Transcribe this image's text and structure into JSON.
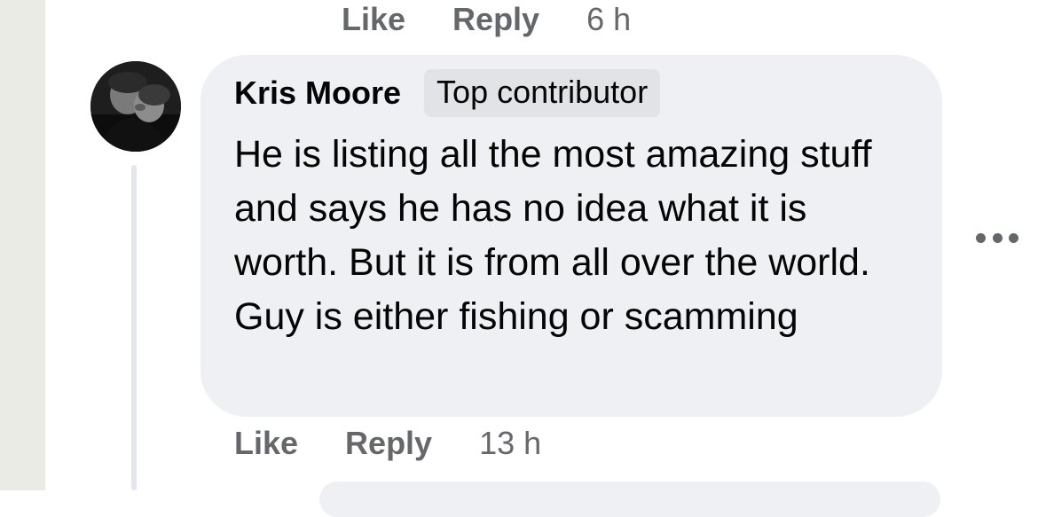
{
  "previous_comment": {
    "like_label": "Like",
    "reply_label": "Reply",
    "timestamp": "6 h"
  },
  "comment": {
    "author": "Kris Moore",
    "badge": "Top contributor",
    "text": "He is listing all the most amazing stuff and says he has no idea what it is worth. But it is from all over the world. Guy is either fishing or scamming",
    "like_label": "Like",
    "reply_label": "Reply",
    "timestamp": "13 h",
    "more_icon": "more-options-icon"
  },
  "colors": {
    "bubble": "#eff0f4",
    "badge": "#e2e3e7",
    "secondary_text": "#65676b",
    "primary_text": "#050505",
    "gutter": "#e9ebe4"
  }
}
